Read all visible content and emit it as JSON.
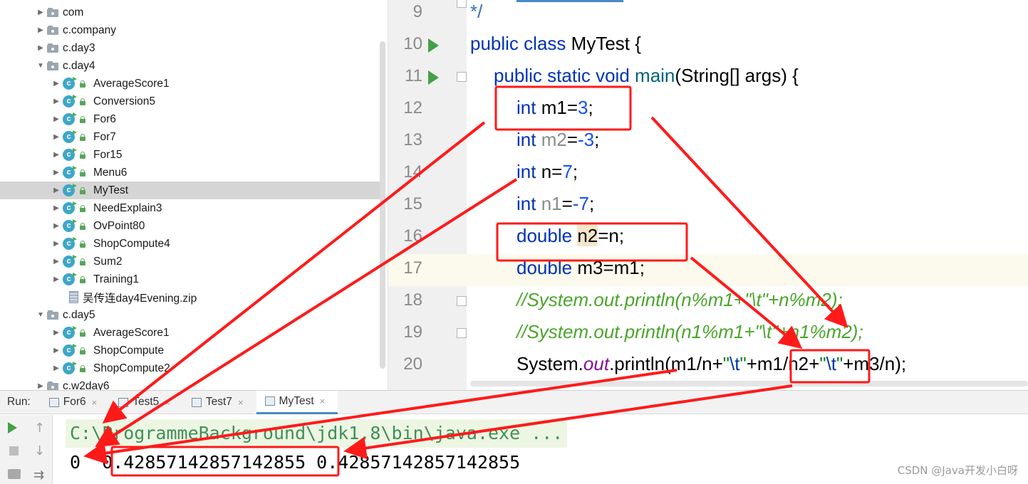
{
  "project_tree": {
    "items": [
      {
        "label": "com",
        "type": "package",
        "expanded": false
      },
      {
        "label": "c.company",
        "type": "package",
        "expanded": false
      },
      {
        "label": "c.day3",
        "type": "package",
        "expanded": false
      },
      {
        "label": "c.day4",
        "type": "package",
        "expanded": true
      },
      {
        "label": "AverageScore1",
        "type": "class"
      },
      {
        "label": "Conversion5",
        "type": "class"
      },
      {
        "label": "For6",
        "type": "class"
      },
      {
        "label": "For7",
        "type": "class"
      },
      {
        "label": "For15",
        "type": "class"
      },
      {
        "label": "Menu6",
        "type": "class"
      },
      {
        "label": "MyTest",
        "type": "class",
        "selected": true
      },
      {
        "label": "NeedExplain3",
        "type": "class"
      },
      {
        "label": "OvPoint80",
        "type": "class"
      },
      {
        "label": "ShopCompute4",
        "type": "class"
      },
      {
        "label": "Sum2",
        "type": "class"
      },
      {
        "label": "Training1",
        "type": "class"
      },
      {
        "label": "吴传连day4Evening.zip",
        "type": "zip"
      },
      {
        "label": "c.day5",
        "type": "package",
        "expanded": true
      },
      {
        "label": "AverageScore1",
        "type": "class"
      },
      {
        "label": "ShopCompute",
        "type": "class"
      },
      {
        "label": "ShopCompute2",
        "type": "class"
      },
      {
        "label": "c.w2day6",
        "type": "package",
        "expanded": false
      }
    ]
  },
  "editor": {
    "line_numbers": [
      "9",
      "10",
      "11",
      "12",
      "13",
      "14",
      "15",
      "16",
      "17",
      "18",
      "19",
      "20"
    ],
    "lines": {
      "l9": {
        "comment_end": "*/"
      },
      "l10": {
        "kw1": "public",
        "kw2": "class",
        "name": "MyTest",
        "rest": " {"
      },
      "l11": {
        "kw1": "public",
        "kw2": "static",
        "kw3": "void",
        "method": "main",
        "rest": "(String[] args) {"
      },
      "l12": {
        "type": "int",
        "name": " m1",
        "eq": "=",
        "value": "3",
        "end": ";"
      },
      "l13": {
        "type": "int",
        "name": " m2",
        "eq": "=",
        "value": "-3",
        "end": ";"
      },
      "l14": {
        "type": "int",
        "name": " n",
        "eq": "=",
        "value": "7",
        "end": ";"
      },
      "l15": {
        "type": "int",
        "name": " n1",
        "eq": "=",
        "value": "-7",
        "end": ";"
      },
      "l16": {
        "type": "double",
        "space": " ",
        "name": "n2",
        "rest": "=n;"
      },
      "l17": {
        "type": "double",
        "space": " ",
        "name": "m3",
        "rest": "=m1;"
      },
      "l18": {
        "comment": "//System.out.println(n%m1+\"\\t\"+n%m2);"
      },
      "l19": {
        "comment": "//System.out.println(n1%m1+\"\\t\"+n1%m2);"
      },
      "l20": {
        "obj": "System.",
        "field": "out",
        "p1": ".println(m1/n+",
        "s1": "\"",
        "e1": "\\t",
        "s1b": "\"",
        "p2": "+m1/n2+",
        "s2": "\"",
        "e2": "\\t",
        "s2b": "\"",
        "p3": "+m3/n);"
      }
    }
  },
  "run_panel": {
    "label": "Run:",
    "tabs": [
      {
        "label": "For6",
        "active": false
      },
      {
        "label": "Test5",
        "active": false
      },
      {
        "label": "Test7",
        "active": false
      },
      {
        "label": "MyTest",
        "active": true
      }
    ],
    "close_glyph": "×",
    "console": {
      "command": "C:\\ProgrammeBackground\\jdk1.8\\bin\\java.exe ...",
      "output": "0  0.42857142857142855 0.42857142857142855"
    }
  },
  "watermark": "CSDN @Java开发小白呀",
  "colors": {
    "keyword": "#0033b3",
    "number": "#1750eb",
    "string": "#067d17",
    "comment": "#4aa52a",
    "annotation_red": "#ff1a1a",
    "run_green": "#45a047"
  },
  "icons": [
    "package-icon",
    "class-icon",
    "lock-icon",
    "zip-icon",
    "run-gutter-icon",
    "fold-icon",
    "rerun-icon",
    "stop-icon",
    "camera-icon",
    "up-icon",
    "down-icon",
    "soft-wrap-icon",
    "tab-file-icon",
    "close-icon"
  ]
}
